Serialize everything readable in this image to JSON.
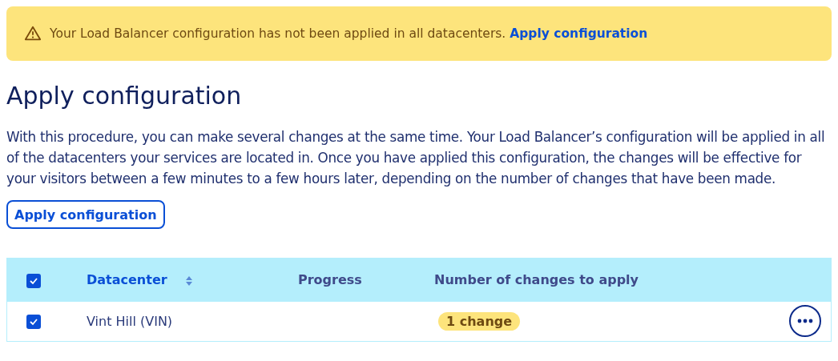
{
  "banner": {
    "message": "Your Load Balancer configuration has not been applied in all datacenters.",
    "link": "Apply configuration"
  },
  "title": "Apply configuration",
  "description": "With this procedure, you can make several changes at the same time. Your Load Balancer’s configuration will be applied in all of the datacenters your services are located in. Once you have applied this configuration, the changes will be effective for your visitors between a few minutes to a few hours later, depending on the number of changes that have been made.",
  "apply_button": "Apply configuration",
  "table": {
    "select_all_checked": true,
    "columns": [
      {
        "label": "Datacenter",
        "sortable": true
      },
      {
        "label": "Progress",
        "sortable": false
      },
      {
        "label": "Number of changes to apply",
        "sortable": false
      }
    ],
    "rows": [
      {
        "checked": true,
        "datacenter": "Vint Hill (VIN)",
        "changes": "1 change"
      }
    ]
  }
}
